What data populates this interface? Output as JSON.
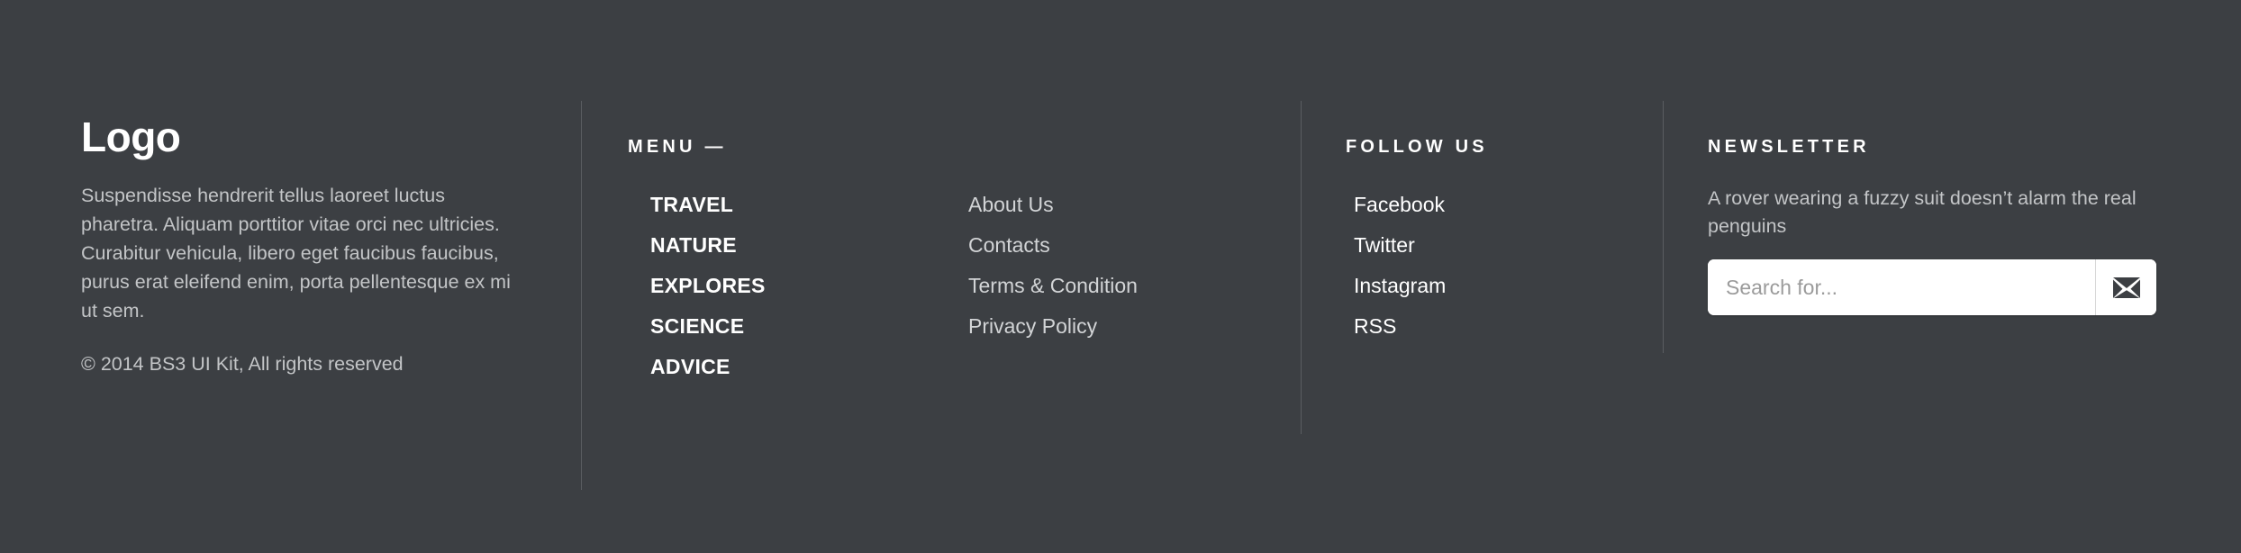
{
  "theme": {
    "background": "#3c3f43",
    "divider": "#5a5d61",
    "text_primary": "#ffffff",
    "text_muted": "#c3c5c7",
    "input_background": "#ffffff",
    "placeholder": "#9b9b9b"
  },
  "brand": {
    "logo": "Logo",
    "description": "Suspendisse hendrerit tellus laoreet luctus pharetra. Aliquam porttitor vitae orci nec ultricies. Curabitur vehicula, libero eget faucibus faucibus, purus erat eleifend enim, porta pellentesque ex mi ut sem.",
    "copyright": "© 2014 BS3 UI Kit, All rights reserved"
  },
  "menu": {
    "heading": "MENU —",
    "items": [
      {
        "label": "TRAVEL"
      },
      {
        "label": "NATURE"
      },
      {
        "label": "EXPLORES"
      },
      {
        "label": "SCIENCE"
      },
      {
        "label": "ADVICE"
      }
    ]
  },
  "pages": {
    "items": [
      {
        "label": "About Us"
      },
      {
        "label": "Contacts"
      },
      {
        "label": "Terms & Condition"
      },
      {
        "label": "Privacy Policy"
      }
    ]
  },
  "follow": {
    "heading": "FOLLOW US",
    "items": [
      {
        "label": "Facebook"
      },
      {
        "label": "Twitter"
      },
      {
        "label": "Instagram"
      },
      {
        "label": "RSS"
      }
    ]
  },
  "newsletter": {
    "heading": "NEWSLETTER",
    "description": "A rover wearing a fuzzy suit doesn’t alarm the real penguins",
    "input_value": "",
    "input_placeholder": "Search for...",
    "submit_icon": "envelope-icon"
  }
}
